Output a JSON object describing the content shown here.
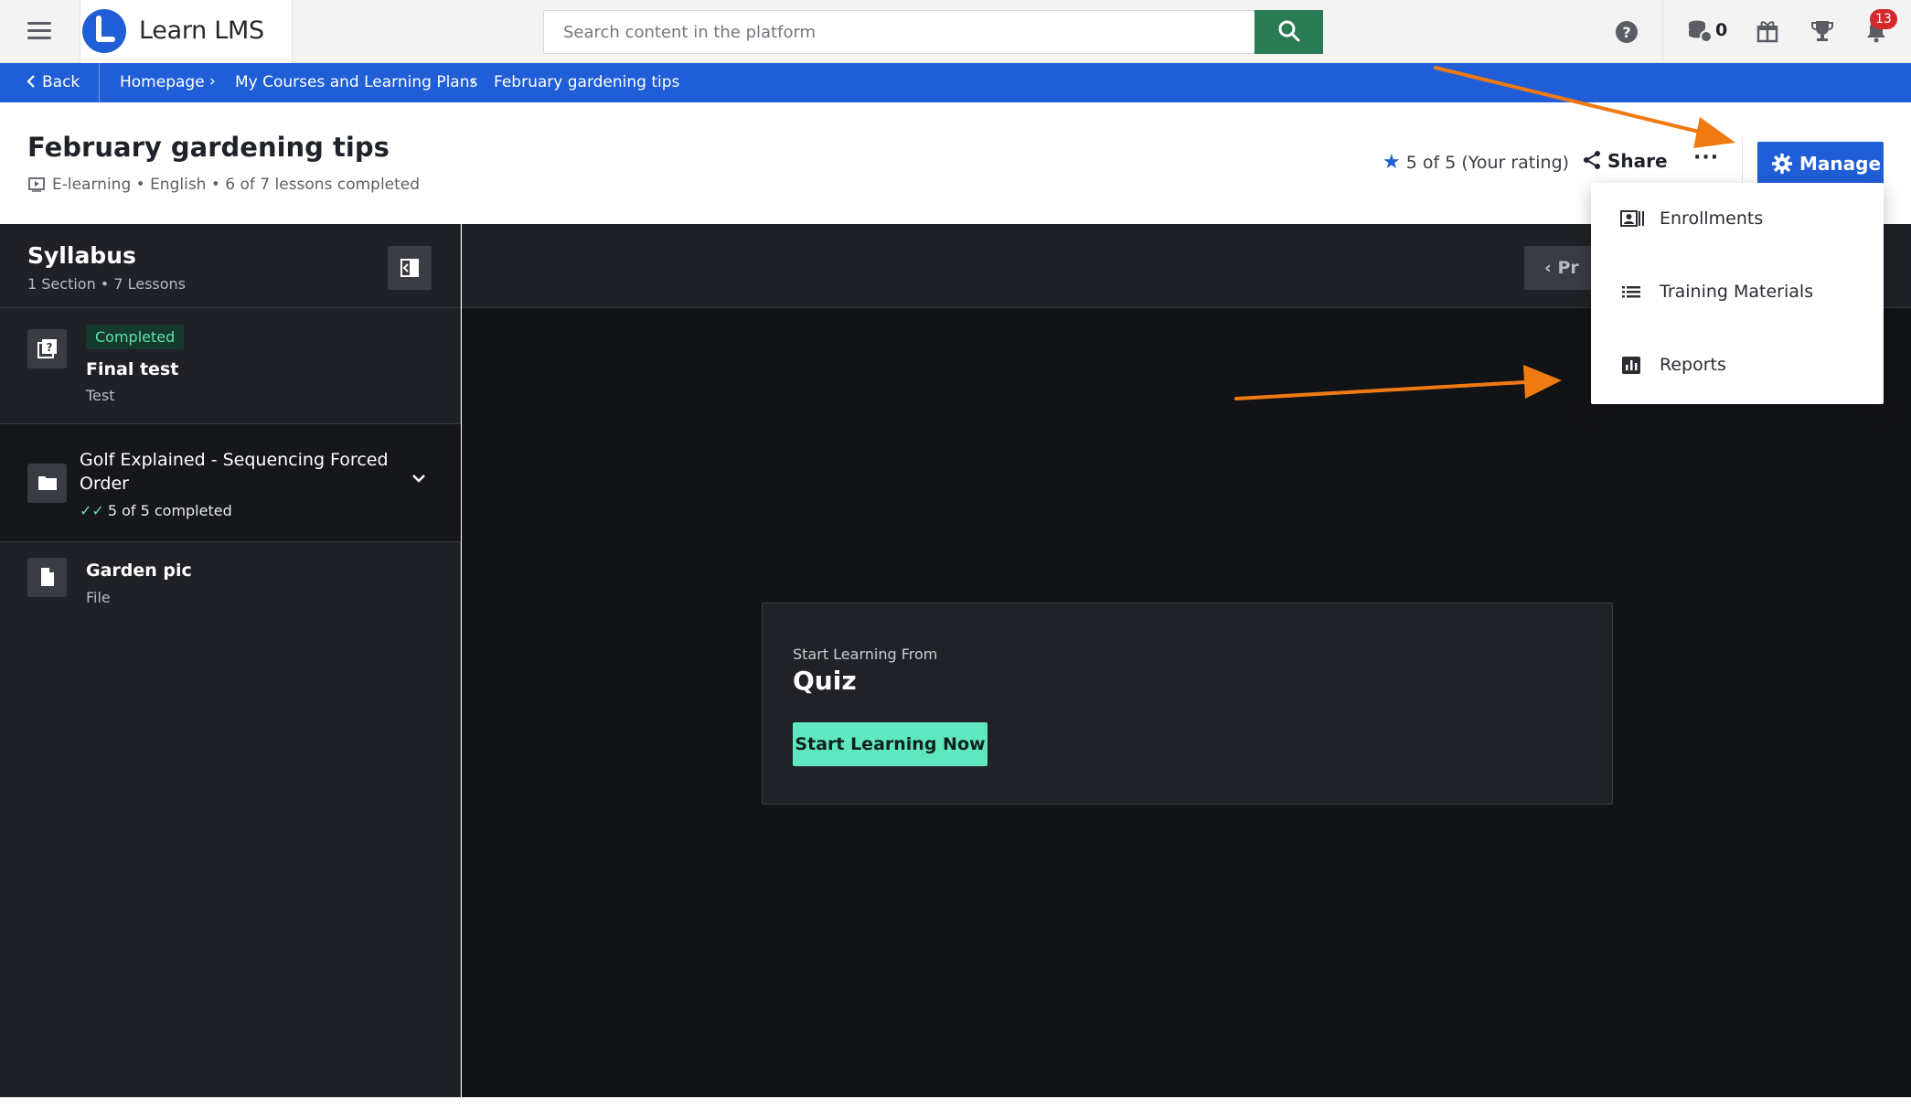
{
  "app": {
    "name": "Learn LMS"
  },
  "search": {
    "placeholder": "Search content in the platform"
  },
  "topbar": {
    "coins_count": "0",
    "notifications_count": "13"
  },
  "breadcrumb": {
    "back_label": "Back",
    "items": [
      "Homepage",
      "My Courses and Learning Plans",
      "February gardening tips"
    ]
  },
  "course": {
    "title": "February gardening tips",
    "meta": "E-learning • English • 6 of 7 lessons completed",
    "rating": "5 of 5 (Your rating)",
    "share_label": "Share",
    "more_label": "···",
    "manage_label": "Manage"
  },
  "manage_menu": {
    "items": [
      "Enrollments",
      "Training Materials",
      "Reports"
    ]
  },
  "syllabus": {
    "title": "Syllabus",
    "summary": "1 Section •  7 Lessons",
    "lessons": [
      {
        "status": "Completed",
        "name": "Final test",
        "type": "Test"
      },
      {
        "name": "Garden pic",
        "type": "File"
      }
    ],
    "section": {
      "name": "Golf Explained - Sequencing Forced Order",
      "progress": "5 of 5 completed"
    }
  },
  "player": {
    "prev_label": "Pr",
    "start_from_label": "Start Learning From",
    "start_item": "Quiz",
    "start_button": "Start Learning Now"
  },
  "colors": {
    "brand_blue": "#1f5ed6",
    "search_green": "#2a7a56",
    "start_button": "#5fe8bf",
    "annotation_arrow": "#f07a12"
  }
}
